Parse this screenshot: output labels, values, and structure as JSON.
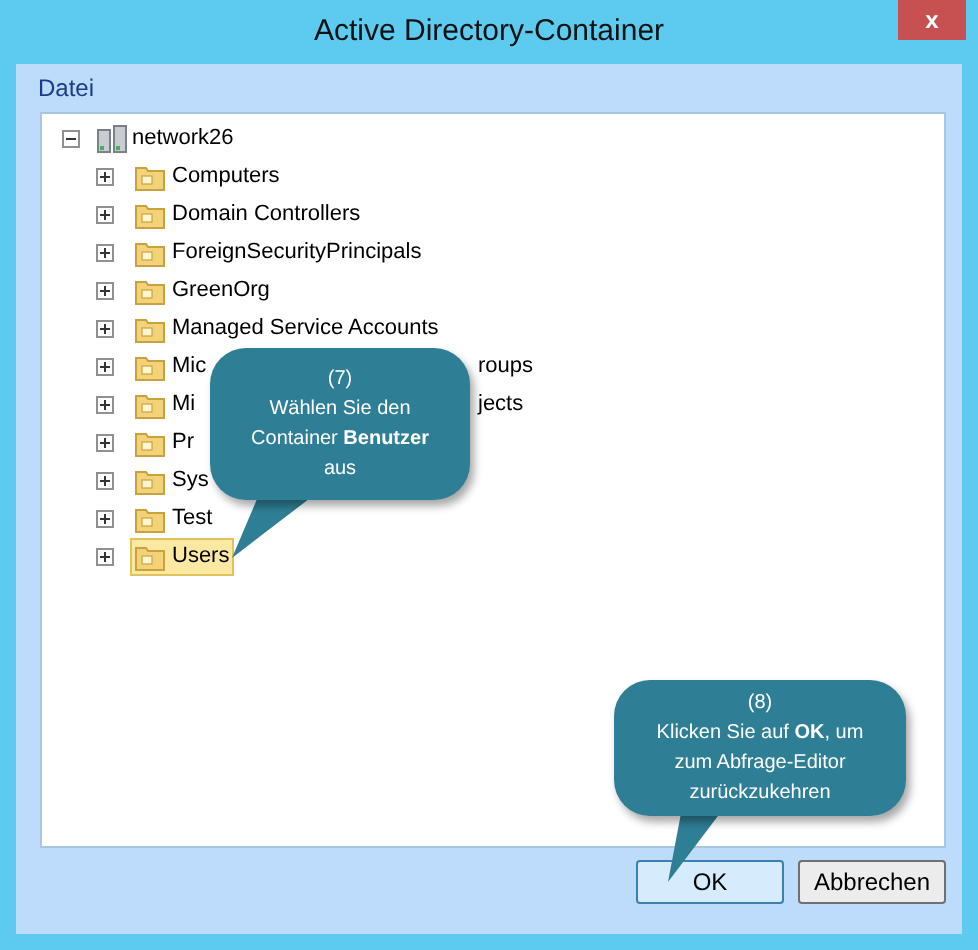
{
  "window": {
    "title": "Active Directory-Container",
    "close": "x"
  },
  "menu": [
    "Datei"
  ],
  "tree": {
    "label": "network26",
    "expanded": true,
    "selected": false,
    "children": [
      {
        "label": "Computers",
        "expanded": false,
        "selected": false
      },
      {
        "label": "Domain Controllers",
        "expanded": false,
        "selected": false
      },
      {
        "label": "ForeignSecurityPrincipals",
        "expanded": false,
        "selected": false
      },
      {
        "label": "GreenOrg",
        "expanded": false,
        "selected": false
      },
      {
        "label": "Managed Service Accounts",
        "expanded": false,
        "selected": false
      },
      {
        "label": "Mic",
        "visible_tail": "roups",
        "expanded": false,
        "selected": false
      },
      {
        "label": "Mi",
        "visible_tail": "jects",
        "expanded": false,
        "selected": false
      },
      {
        "label": "Pr",
        "expanded": false,
        "selected": false
      },
      {
        "label": "Sys",
        "expanded": false,
        "selected": false
      },
      {
        "label": "Test",
        "expanded": false,
        "selected": false
      },
      {
        "label": "Users",
        "expanded": false,
        "selected": true
      }
    ]
  },
  "callouts": [
    {
      "number": "(7)",
      "text": "Wählen Sie den Container **Benutzer** aus"
    },
    {
      "number": "(8)",
      "text": "Klicken Sie auf **OK**, um zum Abfrage-Editor zurückzukehren"
    }
  ],
  "buttons": [
    {
      "label": "OK",
      "selected": true
    },
    {
      "label": "Abbrechen",
      "selected": false
    }
  ]
}
